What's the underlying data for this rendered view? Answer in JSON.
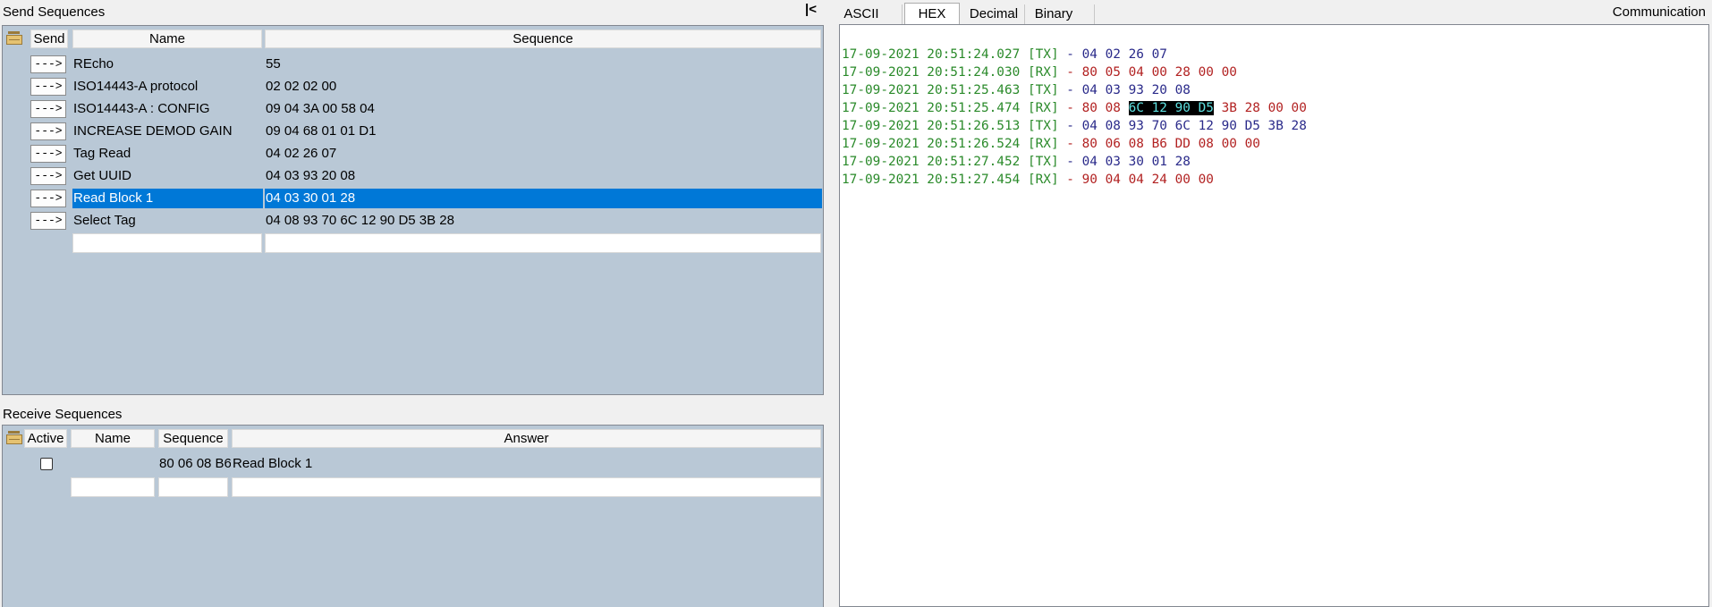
{
  "send_sequences": {
    "title": "Send Sequences",
    "collapse_label": "|<",
    "columns": {
      "send": "Send",
      "name": "Name",
      "sequence": "Sequence"
    },
    "rows": [
      {
        "button": "--->",
        "name": "REcho",
        "sequence": "55",
        "selected": false
      },
      {
        "button": "--->",
        "name": " ISO14443-A protocol",
        "sequence": "02 02 02 00",
        "selected": false
      },
      {
        "button": "--->",
        "name": "ISO14443-A : CONFIG",
        "sequence": "09 04 3A 00 58 04",
        "selected": false
      },
      {
        "button": "--->",
        "name": "INCREASE DEMOD GAIN",
        "sequence": "09 04 68 01 01 D1",
        "selected": false
      },
      {
        "button": "--->",
        "name": "Tag Read",
        "sequence": "04 02 26 07",
        "selected": false
      },
      {
        "button": "--->",
        "name": "Get UUID",
        "sequence": "04 03 93 20 08",
        "selected": false
      },
      {
        "button": "--->",
        "name": "Read Block 1",
        "sequence": "04 03 30 01 28",
        "selected": true
      },
      {
        "button": "--->",
        "name": "Select Tag",
        "sequence": "04 08 93 70 6C 12 90 D5 3B 28",
        "selected": false
      }
    ]
  },
  "receive_sequences": {
    "title": "Receive Sequences",
    "columns": {
      "active": "Active",
      "name": "Name",
      "sequence": "Sequence",
      "answer": "Answer"
    },
    "rows": [
      {
        "active": false,
        "name": "",
        "sequence": "80 06 08 B6",
        "answer": "Read Block 1"
      }
    ]
  },
  "communication": {
    "title": "Communication",
    "tabs": [
      {
        "label": "ASCII",
        "active": false
      },
      {
        "label": "HEX",
        "active": true
      },
      {
        "label": "Decimal",
        "active": false
      },
      {
        "label": "Binary",
        "active": false
      }
    ],
    "log": [
      {
        "timestamp": "17-09-2021 20:51:24.027",
        "direction": "[TX]",
        "sep": "-",
        "bytes": "04 02 26 07",
        "type": "tx"
      },
      {
        "timestamp": "17-09-2021 20:51:24.030",
        "direction": "[RX]",
        "sep": "-",
        "bytes": "80 05 04 00 28 00 00",
        "type": "rx"
      },
      {
        "timestamp": "17-09-2021 20:51:25.463",
        "direction": "[TX]",
        "sep": "-",
        "bytes": "04 03 93 20 08",
        "type": "tx"
      },
      {
        "timestamp": "17-09-2021 20:51:25.474",
        "direction": "[RX]",
        "sep": "-",
        "bytes_before": "80 08 ",
        "bytes_highlighted": "6C 12 90 D5",
        "bytes_after": " 3B 28 00 00",
        "type": "rx"
      },
      {
        "timestamp": "17-09-2021 20:51:26.513",
        "direction": "[TX]",
        "sep": "-",
        "bytes": "04 08 93 70 6C 12 90 D5 3B 28",
        "type": "tx"
      },
      {
        "timestamp": "17-09-2021 20:51:26.524",
        "direction": "[RX]",
        "sep": "-",
        "bytes": "80 06 08 B6 DD 08 00 00",
        "type": "rx"
      },
      {
        "timestamp": "17-09-2021 20:51:27.452",
        "direction": "[TX]",
        "sep": "-",
        "bytes": "04 03 30 01 28",
        "type": "tx"
      },
      {
        "timestamp": "17-09-2021 20:51:27.454",
        "direction": "[RX]",
        "sep": "-",
        "bytes": "90 04 04 24 00 00",
        "type": "rx"
      }
    ],
    "colors": {
      "timestamp": "#2a8a2a",
      "tx": "#2a2a8a",
      "rx": "#b22222",
      "selection_bg": "#0078d7",
      "panel_bg": "#b9c8d6"
    }
  }
}
